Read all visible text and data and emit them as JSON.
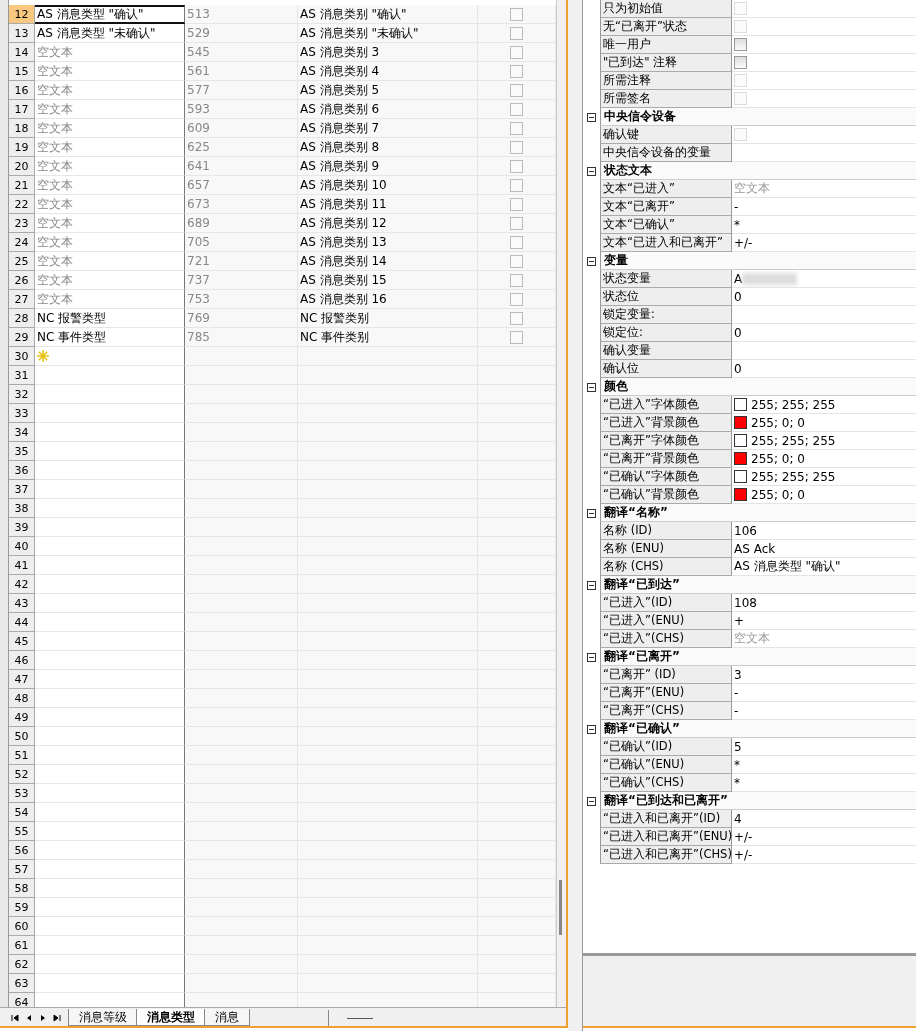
{
  "grid_rows": [
    {
      "number": "12",
      "name": "AS 消息类型 \"确认\"",
      "muted": false,
      "id": "513",
      "text": "AS 消息类别 \"确认\"",
      "checked": false,
      "selected": true
    },
    {
      "number": "13",
      "name": "AS 消息类型 \"未确认\"",
      "muted": false,
      "id": "529",
      "text": "AS 消息类别 \"未确认\"",
      "checked": false,
      "selected": false
    },
    {
      "number": "14",
      "name": "空文本",
      "muted": true,
      "id": "545",
      "text": "AS 消息类别 3",
      "checked": false,
      "selected": false
    },
    {
      "number": "15",
      "name": "空文本",
      "muted": true,
      "id": "561",
      "text": "AS 消息类别 4",
      "checked": false,
      "selected": false
    },
    {
      "number": "16",
      "name": "空文本",
      "muted": true,
      "id": "577",
      "text": "AS 消息类别 5",
      "checked": false,
      "selected": false
    },
    {
      "number": "17",
      "name": "空文本",
      "muted": true,
      "id": "593",
      "text": "AS 消息类别 6",
      "checked": false,
      "selected": false
    },
    {
      "number": "18",
      "name": "空文本",
      "muted": true,
      "id": "609",
      "text": "AS 消息类别 7",
      "checked": false,
      "selected": false
    },
    {
      "number": "19",
      "name": "空文本",
      "muted": true,
      "id": "625",
      "text": "AS 消息类别 8",
      "checked": false,
      "selected": false
    },
    {
      "number": "20",
      "name": "空文本",
      "muted": true,
      "id": "641",
      "text": "AS 消息类别 9",
      "checked": false,
      "selected": false
    },
    {
      "number": "21",
      "name": "空文本",
      "muted": true,
      "id": "657",
      "text": "AS 消息类别 10",
      "checked": false,
      "selected": false
    },
    {
      "number": "22",
      "name": "空文本",
      "muted": true,
      "id": "673",
      "text": "AS 消息类别 11",
      "checked": false,
      "selected": false
    },
    {
      "number": "23",
      "name": "空文本",
      "muted": true,
      "id": "689",
      "text": "AS 消息类别 12",
      "checked": false,
      "selected": false
    },
    {
      "number": "24",
      "name": "空文本",
      "muted": true,
      "id": "705",
      "text": "AS 消息类别 13",
      "checked": false,
      "selected": false
    },
    {
      "number": "25",
      "name": "空文本",
      "muted": true,
      "id": "721",
      "text": "AS 消息类别 14",
      "checked": false,
      "selected": false
    },
    {
      "number": "26",
      "name": "空文本",
      "muted": true,
      "id": "737",
      "text": "AS 消息类别 15",
      "checked": false,
      "selected": false
    },
    {
      "number": "27",
      "name": "空文本",
      "muted": true,
      "id": "753",
      "text": "AS 消息类别 16",
      "checked": false,
      "selected": false
    },
    {
      "number": "28",
      "name": "NC 报警类型",
      "muted": false,
      "id": "769",
      "text": "NC 报警类别",
      "checked": false,
      "selected": false
    },
    {
      "number": "29",
      "name": "NC 事件类型",
      "muted": false,
      "id": "785",
      "text": "NC 事件类别",
      "checked": false,
      "selected": false
    }
  ],
  "new_row": {
    "number": "30"
  },
  "empty_rows": [
    "31",
    "32",
    "33",
    "34",
    "35",
    "36",
    "37",
    "38",
    "39",
    "40",
    "41",
    "42",
    "43",
    "44",
    "45",
    "46",
    "47",
    "48",
    "49",
    "50",
    "51",
    "52",
    "53",
    "54",
    "55",
    "56",
    "57",
    "58",
    "59",
    "60",
    "61",
    "62",
    "63",
    "64"
  ],
  "sheet_tabs": [
    {
      "label": "消息等级",
      "selected": false
    },
    {
      "label": "消息类型",
      "selected": true
    },
    {
      "label": "消息",
      "selected": false
    }
  ],
  "properties": [
    {
      "rows": [
        {
          "kind": "checkbox",
          "label": "只为初始值",
          "checked": false,
          "disabled": true
        },
        {
          "kind": "checkbox",
          "label": "无“已离开”状态",
          "checked": false,
          "disabled": true
        },
        {
          "kind": "checkbox",
          "label": "唯一用户",
          "checked": false,
          "disabled": false
        },
        {
          "kind": "checkbox",
          "label": "\"已到达\" 注释",
          "checked": false,
          "disabled": false
        },
        {
          "kind": "checkbox",
          "label": "所需注释",
          "checked": false,
          "disabled": true
        },
        {
          "kind": "checkbox",
          "label": "所需签名",
          "checked": false,
          "disabled": true
        }
      ]
    },
    {
      "title": "中央信令设备",
      "expanded": true,
      "rows": [
        {
          "kind": "checkbox",
          "label": "确认键",
          "checked": false,
          "disabled": true
        },
        {
          "kind": "blank",
          "label": "中央信令设备的变量"
        }
      ]
    },
    {
      "title": "状态文本",
      "expanded": true,
      "rows": [
        {
          "kind": "text",
          "label": "文本“已进入”",
          "value": "空文本",
          "muted": true
        },
        {
          "kind": "text",
          "label": "文本“已离开”",
          "value": "-",
          "muted": false
        },
        {
          "kind": "text",
          "label": "文本“已确认”",
          "value": "*",
          "muted": false
        },
        {
          "kind": "text",
          "label": "文本“已进入和已离开”",
          "value": "+/-",
          "muted": false
        }
      ]
    },
    {
      "title": "变量",
      "expanded": true,
      "rows": [
        {
          "kind": "redacted",
          "label": "状态变量",
          "value": "A"
        },
        {
          "kind": "text",
          "label": "状态位",
          "value": "0",
          "muted": false
        },
        {
          "kind": "blank",
          "label": "锁定变量:"
        },
        {
          "kind": "text",
          "label": "锁定位:",
          "value": "0",
          "muted": false
        },
        {
          "kind": "blank",
          "label": "确认变量"
        },
        {
          "kind": "text",
          "label": "确认位",
          "value": "0",
          "muted": false
        }
      ]
    },
    {
      "title": "颜色",
      "expanded": true,
      "rows": [
        {
          "kind": "color",
          "label": "“已进入”字体颜色",
          "value": "255; 255; 255",
          "color": "#ffffff"
        },
        {
          "kind": "color",
          "label": "“已进入”背景颜色",
          "value": "255; 0; 0",
          "color": "#ff0000"
        },
        {
          "kind": "color",
          "label": "“已离开”字体颜色",
          "value": "255; 255; 255",
          "color": "#ffffff"
        },
        {
          "kind": "color",
          "label": "“已离开”背景颜色",
          "value": "255; 0; 0",
          "color": "#ff0000"
        },
        {
          "kind": "color",
          "label": "“已确认”字体颜色",
          "value": "255; 255; 255",
          "color": "#ffffff"
        },
        {
          "kind": "color",
          "label": "“已确认”背景颜色",
          "value": "255; 0; 0",
          "color": "#ff0000"
        }
      ]
    },
    {
      "title": "翻译“名称”",
      "expanded": true,
      "rows": [
        {
          "kind": "text",
          "label": "名称 (ID)",
          "value": "106",
          "muted": false
        },
        {
          "kind": "text",
          "label": "名称 (ENU)",
          "value": "AS Ack",
          "muted": false
        },
        {
          "kind": "text",
          "label": "名称 (CHS)",
          "value": "AS 消息类型 \"确认\"",
          "muted": false
        }
      ]
    },
    {
      "title": "翻译“已到达”",
      "expanded": true,
      "rows": [
        {
          "kind": "text",
          "label": "“已进入”(ID)",
          "value": "108",
          "muted": false
        },
        {
          "kind": "text",
          "label": "“已进入”(ENU)",
          "value": "+",
          "muted": false
        },
        {
          "kind": "text",
          "label": "“已进入”(CHS)",
          "value": "空文本",
          "muted": true
        }
      ]
    },
    {
      "title": "翻译“已离开”",
      "expanded": true,
      "rows": [
        {
          "kind": "text",
          "label": "“已离开” (ID)",
          "value": "3",
          "muted": false
        },
        {
          "kind": "text",
          "label": "“已离开”(ENU)",
          "value": "-",
          "muted": false
        },
        {
          "kind": "text",
          "label": "“已离开”(CHS)",
          "value": "-",
          "muted": false
        }
      ]
    },
    {
      "title": "翻译“已确认”",
      "expanded": true,
      "rows": [
        {
          "kind": "text",
          "label": "“已确认”(ID)",
          "value": "5",
          "muted": false
        },
        {
          "kind": "text",
          "label": "“已确认”(ENU)",
          "value": "*",
          "muted": false
        },
        {
          "kind": "text",
          "label": "“已确认”(CHS)",
          "value": "*",
          "muted": false
        }
      ]
    },
    {
      "title": "翻译“已到达和已离开”",
      "expanded": true,
      "rows": [
        {
          "kind": "text",
          "label": "“已进入和已离开”(ID)",
          "value": "4",
          "muted": false
        },
        {
          "kind": "text",
          "label": "“已进入和已离开”(ENU)",
          "value": "+/-",
          "muted": false
        },
        {
          "kind": "text",
          "label": "“已进入和已离开”(CHS)",
          "value": "+/-",
          "muted": false
        }
      ]
    }
  ]
}
